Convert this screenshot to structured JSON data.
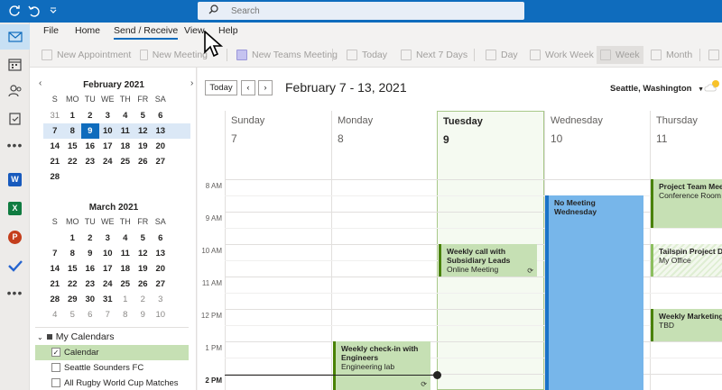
{
  "titlebar": {
    "search_placeholder": "Search"
  },
  "menu": {
    "tabs": [
      "File",
      "Home",
      "Send / Receive",
      "View",
      "Help"
    ],
    "active": "Send / Receive"
  },
  "ribbon": {
    "new_appointment": "New Appointment",
    "new_meeting": "New Meeting",
    "new_teams_meeting": "New Teams Meeting",
    "today": "Today",
    "next_7_days": "Next 7 Days",
    "day": "Day",
    "work_week": "Work Week",
    "week": "Week",
    "month": "Month"
  },
  "mini_calendars": [
    {
      "title": "February 2021",
      "weekdays": [
        "S",
        "MO",
        "TU",
        "WE",
        "TH",
        "FR",
        "SA"
      ],
      "rows": [
        [
          "31",
          "1",
          "2",
          "3",
          "4",
          "5",
          "6"
        ],
        [
          "7",
          "8",
          "9",
          "10",
          "11",
          "12",
          "13"
        ],
        [
          "14",
          "15",
          "16",
          "17",
          "18",
          "19",
          "20"
        ],
        [
          "21",
          "22",
          "23",
          "24",
          "25",
          "26",
          "27"
        ],
        [
          "28",
          "",
          "",
          "",
          "",
          "",
          ""
        ]
      ],
      "today": "9"
    },
    {
      "title": "March 2021",
      "weekdays": [
        "S",
        "MO",
        "TU",
        "WE",
        "TH",
        "FR",
        "SA"
      ],
      "rows": [
        [
          "",
          "1",
          "2",
          "3",
          "4",
          "5",
          "6"
        ],
        [
          "7",
          "8",
          "9",
          "10",
          "11",
          "12",
          "13"
        ],
        [
          "14",
          "15",
          "16",
          "17",
          "18",
          "19",
          "20"
        ],
        [
          "21",
          "22",
          "23",
          "24",
          "25",
          "26",
          "27"
        ],
        [
          "28",
          "29",
          "30",
          "31",
          "1",
          "2",
          "3"
        ],
        [
          "4",
          "5",
          "6",
          "7",
          "8",
          "9",
          "10"
        ]
      ]
    }
  ],
  "calendars": {
    "header": "My Calendars",
    "items": [
      "Calendar",
      "Seattle Sounders FC",
      "All Rugby World Cup Matches"
    ]
  },
  "calendar_view": {
    "today_button": "Today",
    "range_title": "February 7 - 13, 2021",
    "location": "Seattle, Washington",
    "days": [
      {
        "name": "Sunday",
        "num": "7"
      },
      {
        "name": "Monday",
        "num": "8"
      },
      {
        "name": "Tuesday",
        "num": "9"
      },
      {
        "name": "Wednesday",
        "num": "10"
      },
      {
        "name": "Thursday",
        "num": "11"
      }
    ],
    "times": [
      "8 AM",
      "9 AM",
      "10 AM",
      "11 AM",
      "12 PM",
      "1 PM",
      "2 PM"
    ],
    "events": {
      "no_meeting": "No Meeting Wednesday",
      "weekly_call_title": "Weekly call with Subsidiary Leads",
      "weekly_call_loc": "Online Meeting",
      "checkin_title": "Weekly check-in with Engineers",
      "checkin_loc": "Engineering lab",
      "project_team_title": "Project Team Meeting",
      "project_team_loc": "Conference Room - S",
      "tailspin_title": "Tailspin Project Disc",
      "tailspin_loc": "My Office",
      "weekly_marketing_title": "Weekly Marketing L",
      "weekly_marketing_loc": "TBD"
    }
  },
  "colors": {
    "accent": "#0f6cbd",
    "event_green": "#c6e0b4",
    "event_blue": "#77b6ea"
  }
}
